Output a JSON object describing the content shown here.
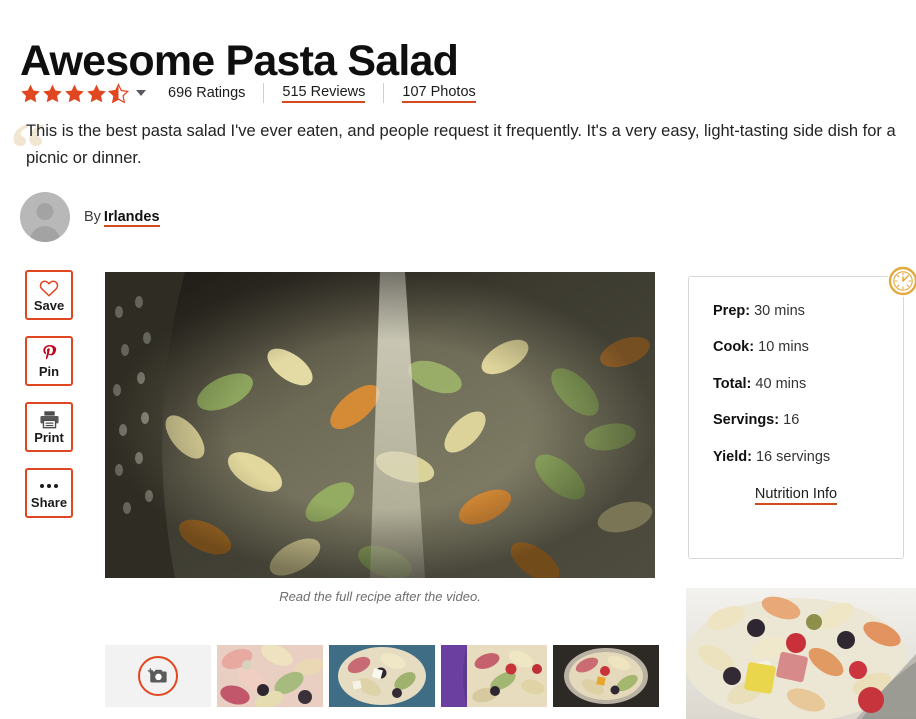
{
  "recipe": {
    "title": "Awesome Pasta Salad",
    "description": "This is the best pasta salad I've ever eaten, and people request it frequently. It's a very easy, light-tasting side dish for a picnic or dinner.",
    "quote_glyph": "“"
  },
  "rating": {
    "value": 4.5,
    "max": 5,
    "full_stars": 4,
    "half_star": true,
    "ratings_text": "696 Ratings",
    "reviews_text": "515 Reviews",
    "photos_text": "107 Photos",
    "dropdown_icon": "chevron-down-icon",
    "star_color": "#e0461f"
  },
  "author": {
    "by_label": "By",
    "name": "Irlandes",
    "avatar_icon": "user-avatar-placeholder"
  },
  "actions": [
    {
      "label": "Save",
      "icon": "heart-icon"
    },
    {
      "label": "Pin",
      "icon": "pinterest-icon"
    },
    {
      "label": "Print",
      "icon": "printer-icon"
    },
    {
      "label": "Share",
      "icon": "ellipsis-icon"
    }
  ],
  "media": {
    "hero_alt": "tri-color rotini pasta being rinsed in a metal colander",
    "video_caption": "Read the full recipe after the video.",
    "add_photo_label": "add-photo-button",
    "thumbnails": [
      {
        "alt": "close-up of tri-color pasta salad with salami and olives"
      },
      {
        "alt": "pasta salad in a blue rimmed bowl"
      },
      {
        "alt": "pasta salad in a purple bowl with tomatoes"
      },
      {
        "alt": "pasta salad in a metal pan"
      }
    ],
    "side_photo_alt": "pasta salad on a white plate with a fork"
  },
  "info_card": {
    "badge_icon": "clock-icon",
    "badge_color": "#e3a93c",
    "rows": [
      {
        "label": "Prep:",
        "value": "30 mins"
      },
      {
        "label": "Cook:",
        "value": "10 mins"
      },
      {
        "label": "Total:",
        "value": "40 mins"
      },
      {
        "label": "Servings:",
        "value": "16"
      },
      {
        "label": "Yield:",
        "value": "16 servings"
      }
    ],
    "nutrition_link": "Nutrition Info"
  },
  "theme": {
    "accent": "#e0461f",
    "underline": "#d24a1f",
    "pinterest_red": "#bd081c",
    "quote_beige": "#f0e6d2"
  }
}
